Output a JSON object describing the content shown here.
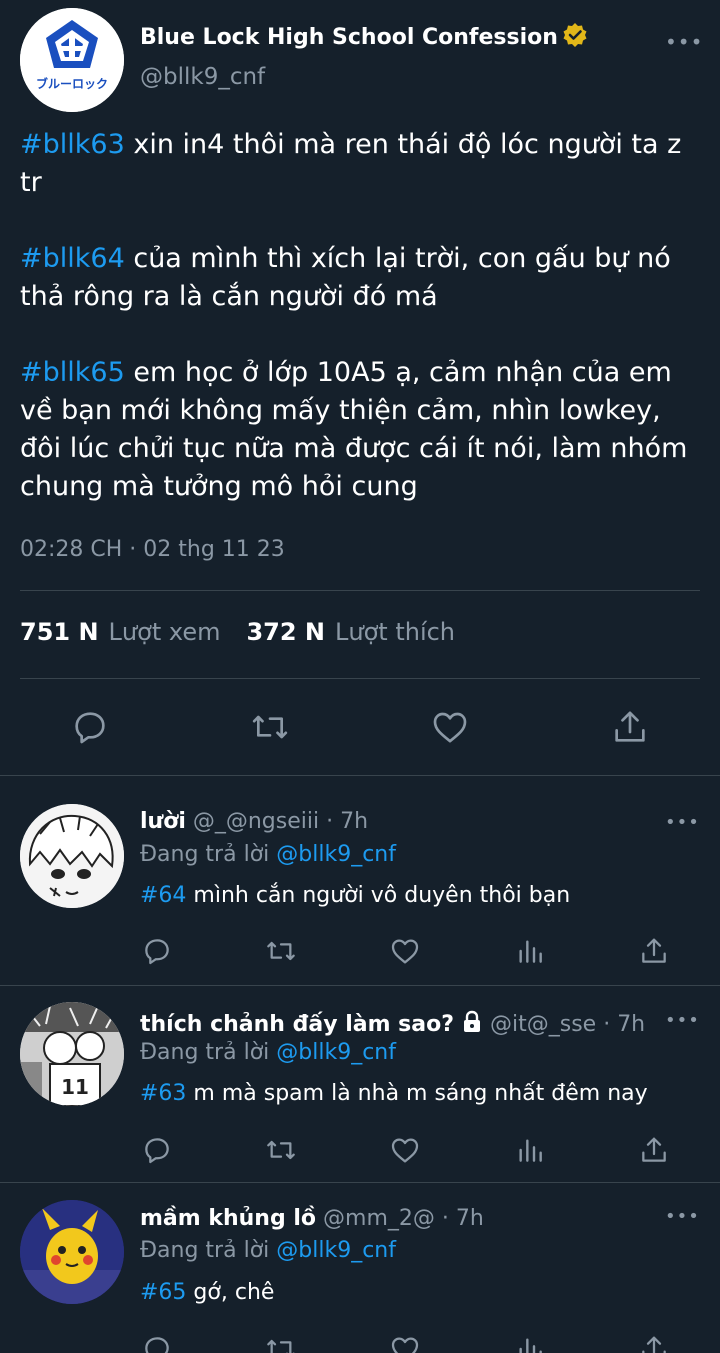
{
  "main_tweet": {
    "author_name": "Blue Lock High School Confession",
    "handle": "@bllk9_cnf",
    "avatar_text": "ブルーロック",
    "paragraphs": [
      {
        "tag": "#bllk63",
        "text": " xin in4 thôi mà ren thái độ lóc người ta z tr"
      },
      {
        "tag": "#bllk64",
        "text": " của mình thì xích lại trời, con gấu bự nó thả rông ra là cắn người đó má"
      },
      {
        "tag": "#bllk65",
        "text": " em học ở lớp 10A5 ạ, cảm nhận của em về bạn mới không mấy thiện cảm, nhìn lowkey, đôi lúc chửi tục nữa mà được cái ít nói, làm nhóm chung mà tưởng mô hỏi cung"
      }
    ],
    "timestamp": "02:28 CH · 02 thg 11 23",
    "views_count": "751 N",
    "views_label": "Lượt xem",
    "likes_count": "372 N",
    "likes_label": "Lượt thích",
    "more": "•••"
  },
  "replies": [
    {
      "name": "lười",
      "handle": "@_@ngseiii",
      "time": "· 7h",
      "replying_prefix": "Đang trả lời ",
      "replying_to": "@bllk9_cnf",
      "tag": "#64",
      "text": " mình cắn người vô duyên thôi bạn",
      "more": "•••"
    },
    {
      "name": "thích chảnh đấy làm sao?",
      "handle": "@it@_sse",
      "time": "· 7h",
      "replying_prefix": "Đang trả lời ",
      "replying_to": "@bllk9_cnf",
      "tag": "#63",
      "text": " m mà spam là nhà m sáng nhất đêm nay",
      "more": "•••"
    },
    {
      "name": "mầm khủng lồ",
      "handle": "@mm_2@",
      "time": "· 7h",
      "replying_prefix": "Đang trả lời ",
      "replying_to": "@bllk9_cnf",
      "tag": "#65",
      "text": " gớ, chê",
      "more": "•••"
    }
  ],
  "colors": {
    "background": "#15202b",
    "accent": "#1d9bf0",
    "muted": "#8b98a5",
    "verified": "#e2b719",
    "divider": "#38444d"
  },
  "icons": {
    "reply": "speech-bubble-icon",
    "retweet": "retweet-icon",
    "like": "heart-icon",
    "share": "share-icon",
    "views": "bar-chart-icon",
    "verified": "verified-badge-icon",
    "lock": "lock-icon"
  }
}
